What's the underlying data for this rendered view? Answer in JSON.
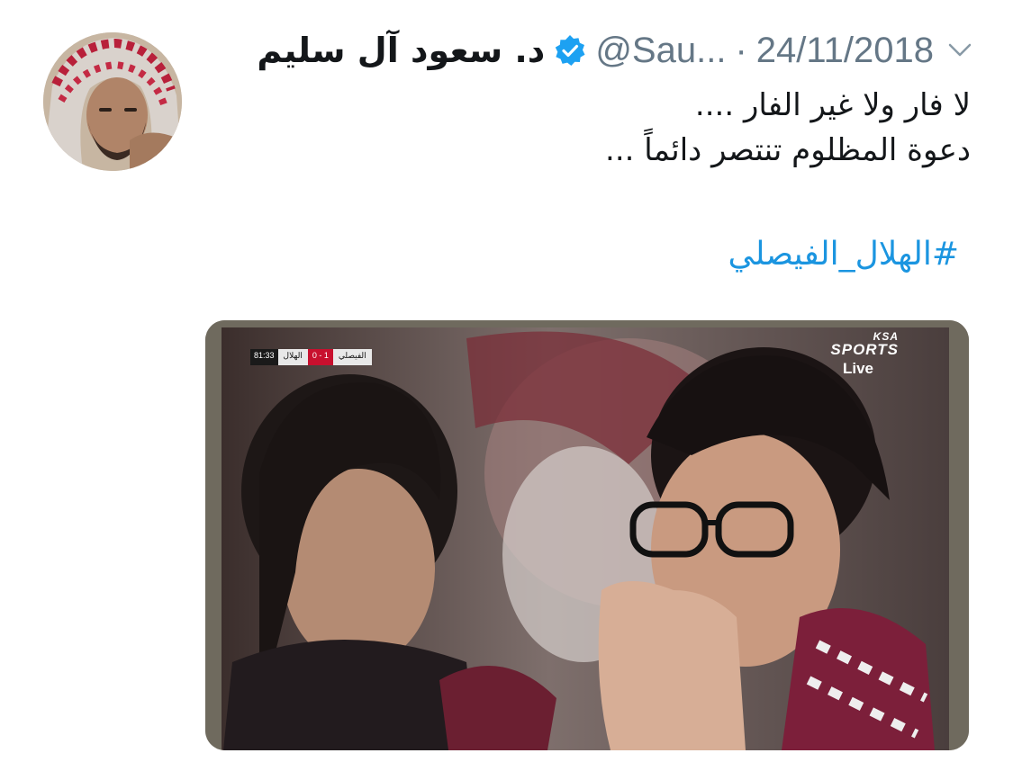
{
  "tweet": {
    "display_name": "د. سعود آل سليم",
    "verified_icon": "verified-badge-icon",
    "handle": "@Sau...",
    "separator": "·",
    "date": "24/11/2018",
    "text_lines": [
      "لا فار ولا غير الفار ....",
      "دعوة المظلوم تنتصر دائماً ..."
    ],
    "hashtag": "#الهلال_الفيصلي"
  },
  "media": {
    "score_bug": {
      "time": "81:33",
      "team_left": "الهلال",
      "score": "0 - 1",
      "team_right": "الفيصلي"
    },
    "broadcast": {
      "brand_top": "KSA",
      "brand_main": "SPORTS",
      "live_label": "Live"
    }
  },
  "colors": {
    "text_primary": "#14171a",
    "text_secondary": "#657786",
    "link": "#1b95e0",
    "verified": "#1da1f2"
  }
}
